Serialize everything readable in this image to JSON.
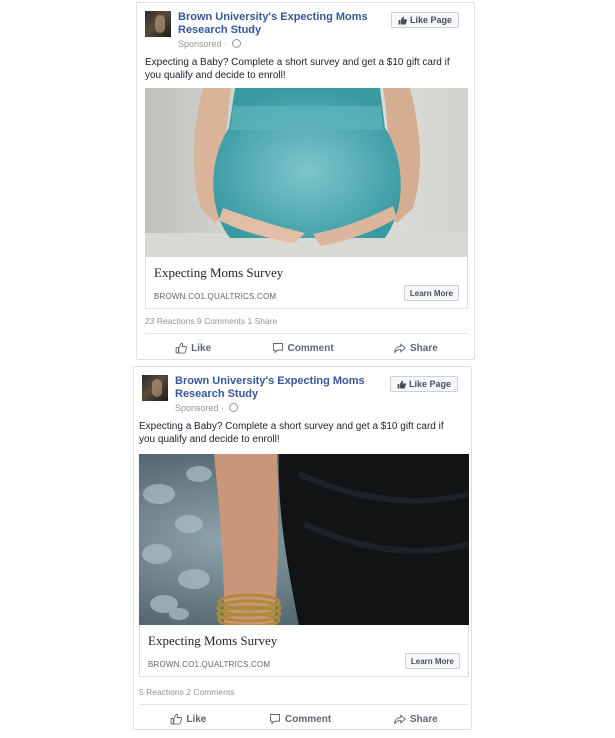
{
  "posts": [
    {
      "page_name": "Brown University's Expecting Moms Research Study",
      "sponsored": "Sponsored",
      "like_page": "Like Page",
      "text": "Expecting a Baby? Complete a short survey and get a $10 gift card if you qualify and decide to enroll!",
      "link_title": "Expecting Moms Survey",
      "link_domain": "BROWN.CO1.QUALTRICS.COM",
      "cta": "Learn More",
      "counts": "23 Reactions  9 Comments  1 Share",
      "actions": {
        "like": "Like",
        "comment": "Comment",
        "share": "Share"
      },
      "icons": [
        "thumbs-up-icon",
        "comment-icon",
        "share-icon",
        "globe-icon"
      ]
    },
    {
      "page_name": "Brown University's Expecting Moms Research Study",
      "sponsored": "Sponsored",
      "like_page": "Like Page",
      "text": "Expecting a Baby? Complete a short survey and get a $10 gift card if you qualify and decide to enroll!",
      "link_title": "Expecting Moms Survey",
      "link_domain": "BROWN.CO1.QUALTRICS.COM",
      "cta": "Learn More",
      "counts": "5 Reactions  2 Comments",
      "actions": {
        "like": "Like",
        "comment": "Comment",
        "share": "Share"
      },
      "icons": [
        "thumbs-up-icon",
        "comment-icon",
        "share-icon",
        "globe-icon"
      ]
    }
  ],
  "colors": {
    "link_blue": "#365899",
    "meta_gray": "#90949c",
    "border": "#dddfe2"
  }
}
